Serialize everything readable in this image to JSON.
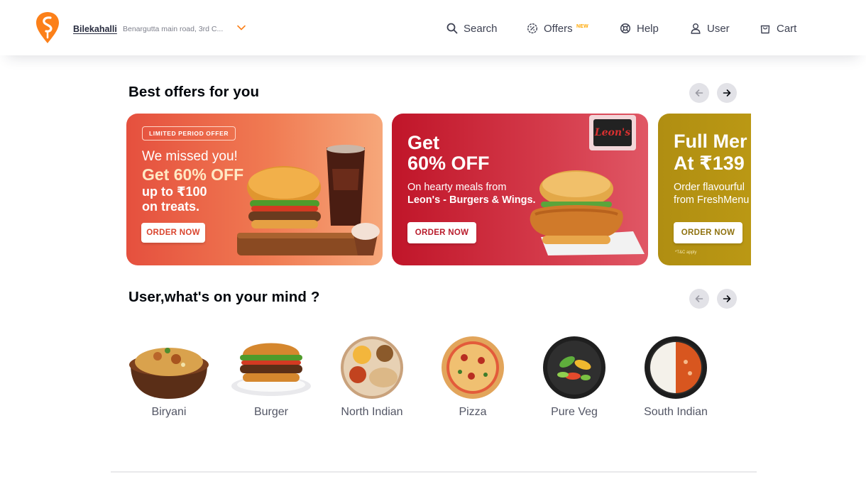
{
  "header": {
    "location_name": "Bilekahalli",
    "location_address": "Benargutta main road, 3rd C...",
    "nav": [
      {
        "label": "Search",
        "icon": "search-icon"
      },
      {
        "label": "Offers",
        "icon": "offers-icon",
        "badge": "NEW"
      },
      {
        "label": "Help",
        "icon": "help-icon"
      },
      {
        "label": "User",
        "icon": "user-icon"
      },
      {
        "label": "Cart",
        "icon": "cart-icon"
      }
    ]
  },
  "offers": {
    "title": "Best offers for you",
    "cards": [
      {
        "tag": "LIMITED PERIOD OFFER",
        "line1": "We missed you!",
        "line2": "Get 60% OFF",
        "line3": "up to ₹100",
        "line4": "on treats.",
        "button": "ORDER NOW"
      },
      {
        "logo": "Leon's",
        "line1": "Get",
        "line2": "60% OFF",
        "line3": "On hearty meals from",
        "line4": "Leon's - Burgers & Wings.",
        "button": "ORDER NOW"
      },
      {
        "line1": "Full Mer",
        "line2": "At ₹139",
        "line3": "Order flavourful",
        "line4": "from FreshMenu",
        "button": "ORDER NOW",
        "note": "*T&C apply"
      }
    ]
  },
  "mind": {
    "title": "User,what's on your mind ?",
    "items": [
      "Biryani",
      "Burger",
      "North Indian",
      "Pizza",
      "Pure Veg",
      "South Indian"
    ]
  },
  "colors": {
    "brand": "#fc8019",
    "card1": "#e5503e",
    "card2": "#c01529",
    "card3": "#b08e12"
  }
}
